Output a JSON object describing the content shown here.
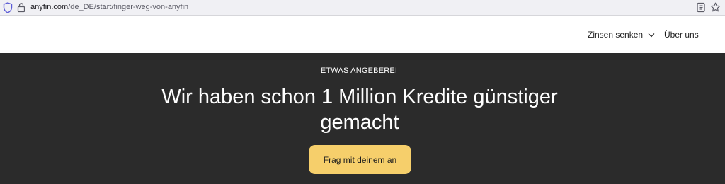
{
  "browser": {
    "url_host": "anyfin.com",
    "url_path": "/de_DE/start/finger-weg-von-anyfin",
    "icons": [
      "shield-icon",
      "lock-icon",
      "reader-mode-icon",
      "bookmark-star-icon"
    ]
  },
  "header": {
    "nav": {
      "zinsen_label": "Zinsen senken",
      "ueber_label": "Über uns"
    }
  },
  "hero": {
    "eyebrow": "ETWAS ANGEBEREI",
    "headline": "Wir haben schon 1 Million Kredite günstiger gemacht",
    "cta_label": "Frag mit deinem an"
  },
  "colors": {
    "hero_bg": "#2b2b2b",
    "cta_bg": "#f6cf6b",
    "header_bg": "#ffffff"
  }
}
